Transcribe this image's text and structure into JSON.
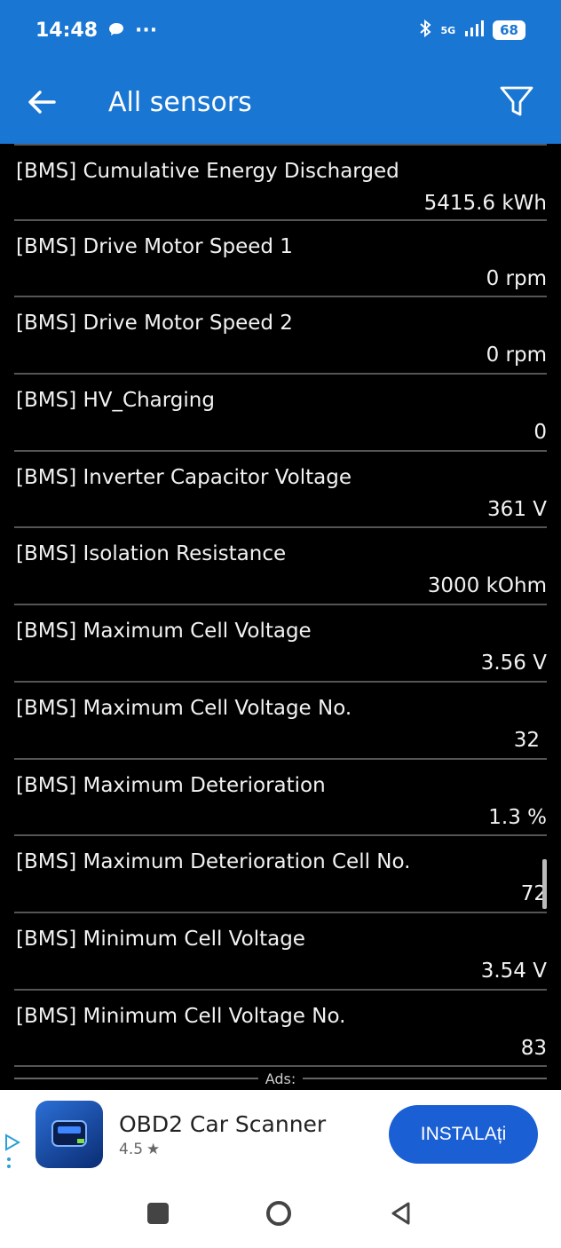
{
  "status": {
    "time": "14:48",
    "more": "···",
    "network": "5G",
    "battery": "68"
  },
  "appbar": {
    "title": "All sensors"
  },
  "sensors": [
    {
      "name": "[BMS] Cumulative Energy Discharged",
      "value": "5415.6 kWh"
    },
    {
      "name": "[BMS] Drive Motor Speed 1",
      "value": "0 rpm"
    },
    {
      "name": "[BMS] Drive Motor Speed 2",
      "value": "0 rpm"
    },
    {
      "name": "[BMS] HV_Charging",
      "value": "0"
    },
    {
      "name": "[BMS] Inverter Capacitor Voltage",
      "value": "361 V"
    },
    {
      "name": "[BMS] Isolation Resistance",
      "value": "3000 kOhm"
    },
    {
      "name": "[BMS] Maximum Cell Voltage",
      "value": "3.56 V"
    },
    {
      "name": "[BMS] Maximum Cell Voltage No.",
      "value": "32"
    },
    {
      "name": "[BMS] Maximum Deterioration",
      "value": "1.3 %"
    },
    {
      "name": "[BMS] Maximum Deterioration Cell No.",
      "value": "72"
    },
    {
      "name": "[BMS] Minimum Cell Voltage",
      "value": "3.54 V"
    },
    {
      "name": "[BMS] Minimum Cell Voltage No.",
      "value": "83"
    }
  ],
  "ads": {
    "label": "Ads:",
    "app_name": "OBD2 Car Scanner",
    "rating": "4.5",
    "install_label": "INSTALAți"
  },
  "icons": {
    "back": "arrow-left-icon",
    "filter": "filter-icon",
    "star": "star-icon"
  },
  "colors": {
    "appbar": "#1976d2",
    "install_button": "#1a5fd4"
  }
}
